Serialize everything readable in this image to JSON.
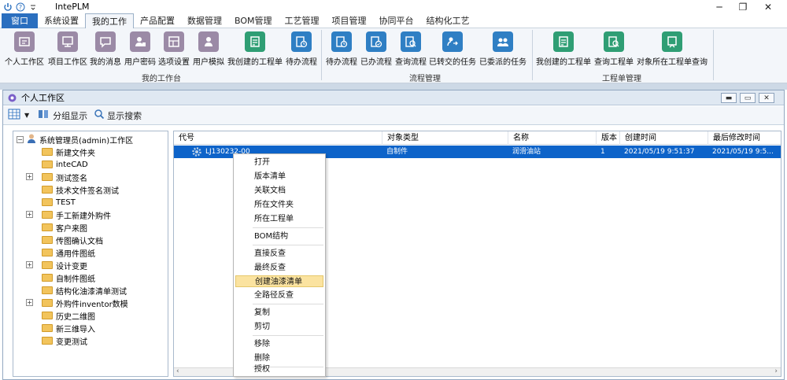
{
  "app": {
    "title": "IntePLM"
  },
  "menubar": {
    "items": [
      "窗口",
      "系统设置",
      "我的工作",
      "产品配置",
      "数据管理",
      "BOM管理",
      "工艺管理",
      "项目管理",
      "协同平台",
      "结构化工艺"
    ]
  },
  "ribbon": {
    "buttons": [
      {
        "label": "个人工作区",
        "icon": "personal-workspace-icon",
        "color": "#9b8aa6"
      },
      {
        "label": "项目工作区",
        "icon": "project-workspace-icon",
        "color": "#9b8aa6"
      },
      {
        "label": "我的消息",
        "icon": "message-icon",
        "color": "#9b8aa6"
      },
      {
        "label": "用户密码",
        "icon": "user-password-icon",
        "color": "#9b8aa6"
      },
      {
        "label": "选项设置",
        "icon": "options-icon",
        "color": "#9b8aa6"
      },
      {
        "label": "用户模拟",
        "icon": "user-simulate-icon",
        "color": "#9b8aa6"
      },
      {
        "label": "我创建的工程单",
        "icon": "created-order-icon",
        "color": "#2f9e74"
      },
      {
        "label": "待办流程",
        "icon": "todo-flow-icon",
        "color": "#2f7fc4"
      },
      {
        "label": "待办流程",
        "icon": "todo-flow-icon",
        "color": "#2f7fc4"
      },
      {
        "label": "已办流程",
        "icon": "done-flow-icon",
        "color": "#2f7fc4"
      },
      {
        "label": "查询流程",
        "icon": "search-flow-icon",
        "color": "#2f7fc4"
      },
      {
        "label": "已转交的任务",
        "icon": "transferred-task-icon",
        "color": "#2f7fc4"
      },
      {
        "label": "已委派的任务",
        "icon": "delegated-task-icon",
        "color": "#2f7fc4"
      },
      {
        "label": "我创建的工程单",
        "icon": "created-order-icon",
        "color": "#2f9e74"
      },
      {
        "label": "查询工程单",
        "icon": "search-order-icon",
        "color": "#2f9e74"
      },
      {
        "label": "对象所在工程单查询",
        "icon": "object-order-query-icon",
        "color": "#2f9e74"
      }
    ],
    "groups": [
      "我的工作台",
      "流程管理",
      "工程单管理"
    ]
  },
  "panel": {
    "title": "个人工作区",
    "toolbar": {
      "group_display": "分组显示",
      "show_search": "显示搜索"
    }
  },
  "tree": {
    "root": "系统管理员(admin)工作区",
    "items": [
      {
        "label": "新建文件夹",
        "expandable": false
      },
      {
        "label": "inteCAD",
        "expandable": false
      },
      {
        "label": "测试签名",
        "expandable": true
      },
      {
        "label": "技术文件签名测试",
        "expandable": false
      },
      {
        "label": "TEST",
        "expandable": false
      },
      {
        "label": "手工新建外购件",
        "expandable": true
      },
      {
        "label": "客户来图",
        "expandable": false
      },
      {
        "label": "传图确认文档",
        "expandable": false
      },
      {
        "label": "通用件图纸",
        "expandable": false
      },
      {
        "label": "设计变更",
        "expandable": true
      },
      {
        "label": "自制件图纸",
        "expandable": false
      },
      {
        "label": "结构化油漆清单测试",
        "expandable": false
      },
      {
        "label": "外购件inventor数模",
        "expandable": true
      },
      {
        "label": "历史二维图",
        "expandable": false
      },
      {
        "label": "新三维导入",
        "expandable": false
      },
      {
        "label": "变更测试",
        "expandable": false
      }
    ]
  },
  "grid": {
    "columns": [
      "代号",
      "对象类型",
      "名称",
      "版本",
      "创建时间",
      "最后修改时间"
    ],
    "rows": [
      {
        "code": "LJ130232-00",
        "type": "自制件",
        "name": "润滑油站",
        "version": "1",
        "created": "2021/05/19 9:51:37",
        "modified": "2021/05/19 9:5..."
      }
    ]
  },
  "context_menu": {
    "items": [
      "打开",
      "版本清单",
      "关联文档",
      "所在文件夹",
      "所在工程单",
      "BOM结构",
      "直接反查",
      "最终反查",
      "创建油漆清单",
      "全路径反查",
      "复制",
      "剪切",
      "移除",
      "删除",
      "授权"
    ],
    "highlighted": "创建油漆清单"
  },
  "colors": {
    "window_menu": "#2b6fbf",
    "selected_row": "#0d63c9",
    "highlight": "#fbe3a0"
  }
}
